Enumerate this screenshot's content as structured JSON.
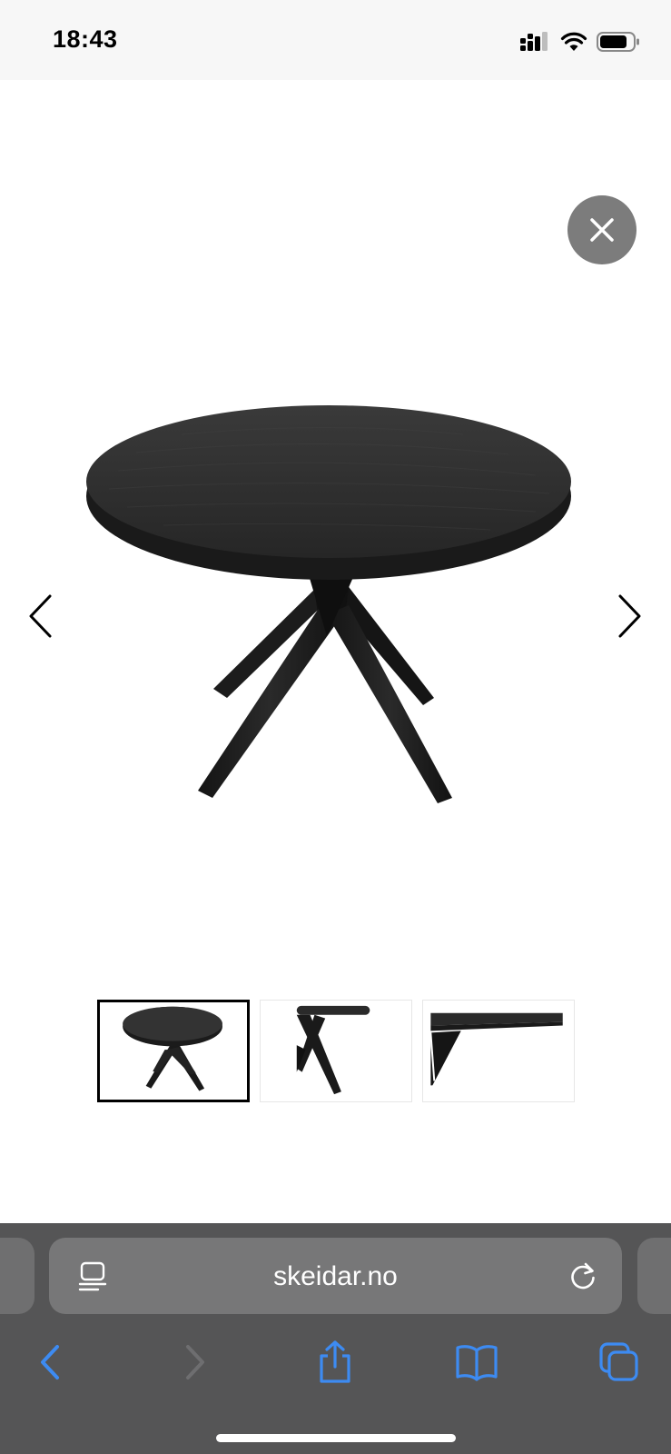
{
  "status_bar": {
    "time": "18:43",
    "icons": [
      "cellular-signal-icon",
      "wifi-icon",
      "battery-icon"
    ]
  },
  "viewer": {
    "close_icon": "close-icon",
    "prev_icon": "chevron-left-icon",
    "next_icon": "chevron-right-icon",
    "thumbnails": [
      {
        "name": "thumbnail-full-table",
        "active": true
      },
      {
        "name": "thumbnail-side-view",
        "active": false
      },
      {
        "name": "thumbnail-edge-detail",
        "active": false
      }
    ]
  },
  "safari": {
    "address": "skeidar.no",
    "reader_icon": "reader-mode-icon",
    "reload_icon": "reload-icon",
    "toolbar_icons": [
      "back-icon",
      "forward-icon",
      "share-icon",
      "bookmarks-icon",
      "tabs-icon"
    ]
  },
  "colors": {
    "status_bar_bg": "#f7f7f7",
    "close_button_bg": "#7c7c7c",
    "safari_bg": "#555556",
    "address_bar_bg": "#777778",
    "toolbar_accent": "#3d8bf2",
    "table_color": "#262626"
  }
}
